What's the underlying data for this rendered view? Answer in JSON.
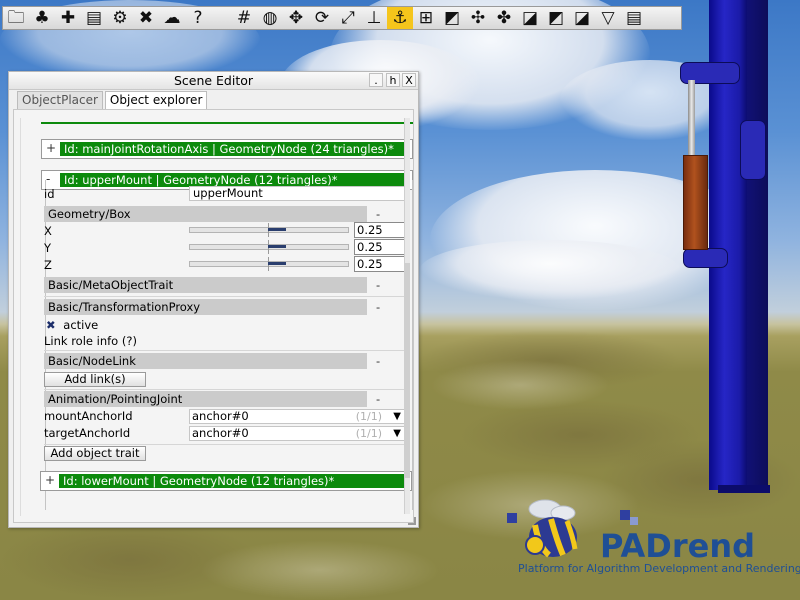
{
  "toolbar": {
    "icons": [
      {
        "name": "folder-icon",
        "glyph": "🗀"
      },
      {
        "name": "plant-icon",
        "glyph": "♣"
      },
      {
        "name": "puzzle-icon",
        "glyph": "✚"
      },
      {
        "name": "list-icon",
        "glyph": "▤"
      },
      {
        "name": "gear-icon",
        "glyph": "⚙"
      },
      {
        "name": "tools-icon",
        "glyph": "✖"
      },
      {
        "name": "weather-icon",
        "glyph": "☁"
      },
      {
        "name": "help-icon",
        "glyph": "?"
      },
      {
        "name": "numbers-icon",
        "glyph": "#"
      },
      {
        "name": "camera-icon",
        "glyph": "◍"
      },
      {
        "name": "move-icon",
        "glyph": "✥"
      },
      {
        "name": "rotate-icon",
        "glyph": "⟳"
      },
      {
        "name": "scale-icon",
        "glyph": "⤢"
      },
      {
        "name": "snap-icon",
        "glyph": "⊥"
      },
      {
        "name": "anchor-icon",
        "glyph": "⚓"
      },
      {
        "name": "measure-icon",
        "glyph": "⊞"
      },
      {
        "name": "edit-mode-1-icon",
        "glyph": "◩"
      },
      {
        "name": "edit-mode-2-icon",
        "glyph": "✣"
      },
      {
        "name": "edit-mode-3-icon",
        "glyph": "✤"
      },
      {
        "name": "edit-mode-4-icon",
        "glyph": "◪"
      },
      {
        "name": "edit-mode-5-icon",
        "glyph": "◩"
      },
      {
        "name": "edit-mode-6-icon",
        "glyph": "◪"
      },
      {
        "name": "edit-mode-7-icon",
        "glyph": "▽"
      },
      {
        "name": "notes-icon",
        "glyph": "▤"
      }
    ],
    "active_icon": "anchor-icon"
  },
  "editor": {
    "title": "Scene Editor",
    "btn_dot": ".",
    "btn_h": "h",
    "btn_x": "X",
    "tabs": [
      {
        "label": "ObjectPlacer",
        "active": false
      },
      {
        "label": "Object explorer",
        "active": true
      }
    ],
    "nodes": {
      "main_joint": {
        "toggle": "+",
        "label": "Id: mainJointRotationAxis | GeometryNode (24 triangles)*"
      },
      "upper_mount": {
        "toggle": "-",
        "label": "Id: upperMount | GeometryNode (12 triangles)*"
      },
      "lower_mount": {
        "toggle": "+",
        "label": "Id: lowerMount | GeometryNode (12 triangles)*"
      }
    },
    "id_label": "id",
    "id_value": "upperMount",
    "geometry_box": {
      "header": "Geometry/Box",
      "collapse": "-",
      "x_label": "X",
      "x_value": "0.25",
      "y_label": "Y",
      "y_value": "0.25",
      "z_label": "Z",
      "z_value": "0.25"
    },
    "meta_trait": {
      "header": "Basic/MetaObjectTrait",
      "collapse": "-"
    },
    "transform_proxy": {
      "header": "Basic/TransformationProxy",
      "collapse": "-",
      "active_label": "active",
      "active_checked": true,
      "link_role_info": "Link role info (?)"
    },
    "node_link": {
      "header": "Basic/NodeLink",
      "collapse": "-",
      "add_links": "Add link(s)"
    },
    "pointing_joint": {
      "header": "Animation/PointingJoint",
      "collapse": "-",
      "mount_label": "mountAnchorId",
      "mount_value": "anchor#0",
      "mount_count": "(1/1)",
      "target_label": "targetAnchorId",
      "target_value": "anchor#0",
      "target_count": "(1/1)"
    },
    "add_object_trait": "Add object trait"
  },
  "logo": {
    "title": "PADrend",
    "subtitle": "Platform for Algorithm Development and Rendering"
  },
  "colors": {
    "node_green": "#0c8a0c",
    "pole_blue": "#2626c6",
    "piston_brown": "#b0521e",
    "logo_blue": "#1f4f95",
    "toolbar_active": "#f5c51b"
  }
}
